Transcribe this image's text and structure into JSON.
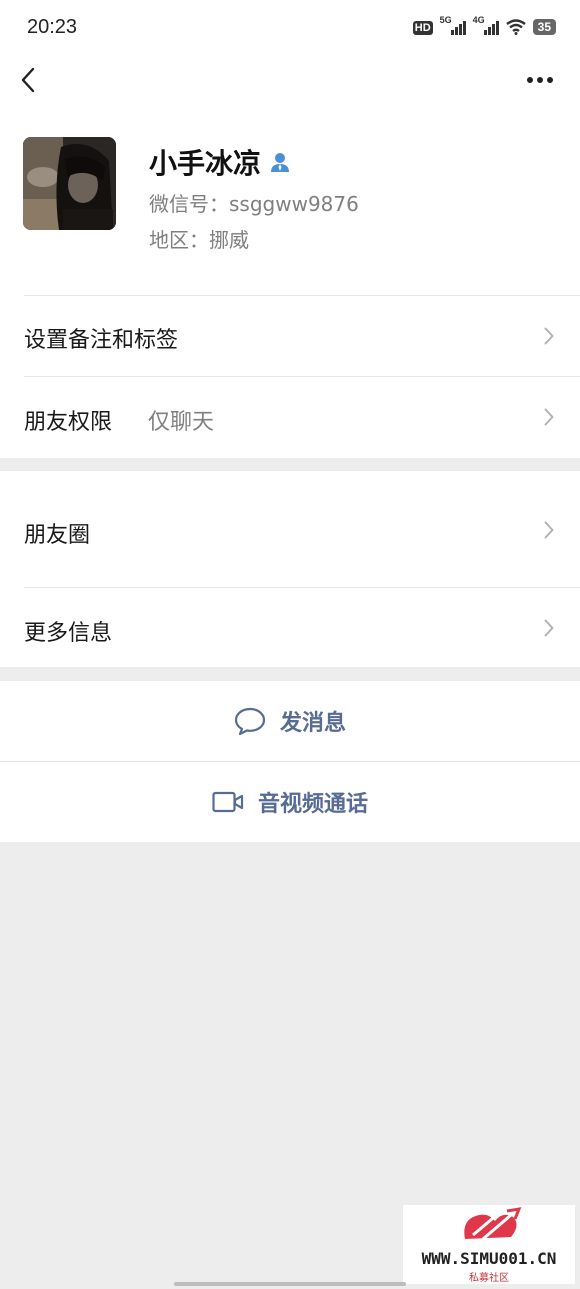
{
  "status_bar": {
    "time": "20:23",
    "hd_label": "HD",
    "signal_1_label": "5G",
    "signal_2_label": "4G",
    "battery": "35"
  },
  "profile": {
    "name": "小手冰凉",
    "wechat_id": "微信号：ssggww9876",
    "region": "地区：挪威"
  },
  "menu": {
    "remark_label": "设置备注和标签",
    "permission_label": "朋友权限",
    "permission_value": "仅聊天",
    "moments_label": "朋友圈",
    "more_info_label": "更多信息"
  },
  "actions": {
    "message_label": "发消息",
    "video_call_label": "音视频通话"
  },
  "watermark": {
    "site": "WWW.SIMU001.CN",
    "sub": "私募社区"
  },
  "colors": {
    "link_blue": "#576b95",
    "background": "#ededed",
    "verified_icon": "#4a90d9"
  },
  "icons": [
    "back-icon",
    "more-icon",
    "person-icon",
    "chevron-right-icon",
    "chat-bubble-icon",
    "video-camera-icon"
  ]
}
